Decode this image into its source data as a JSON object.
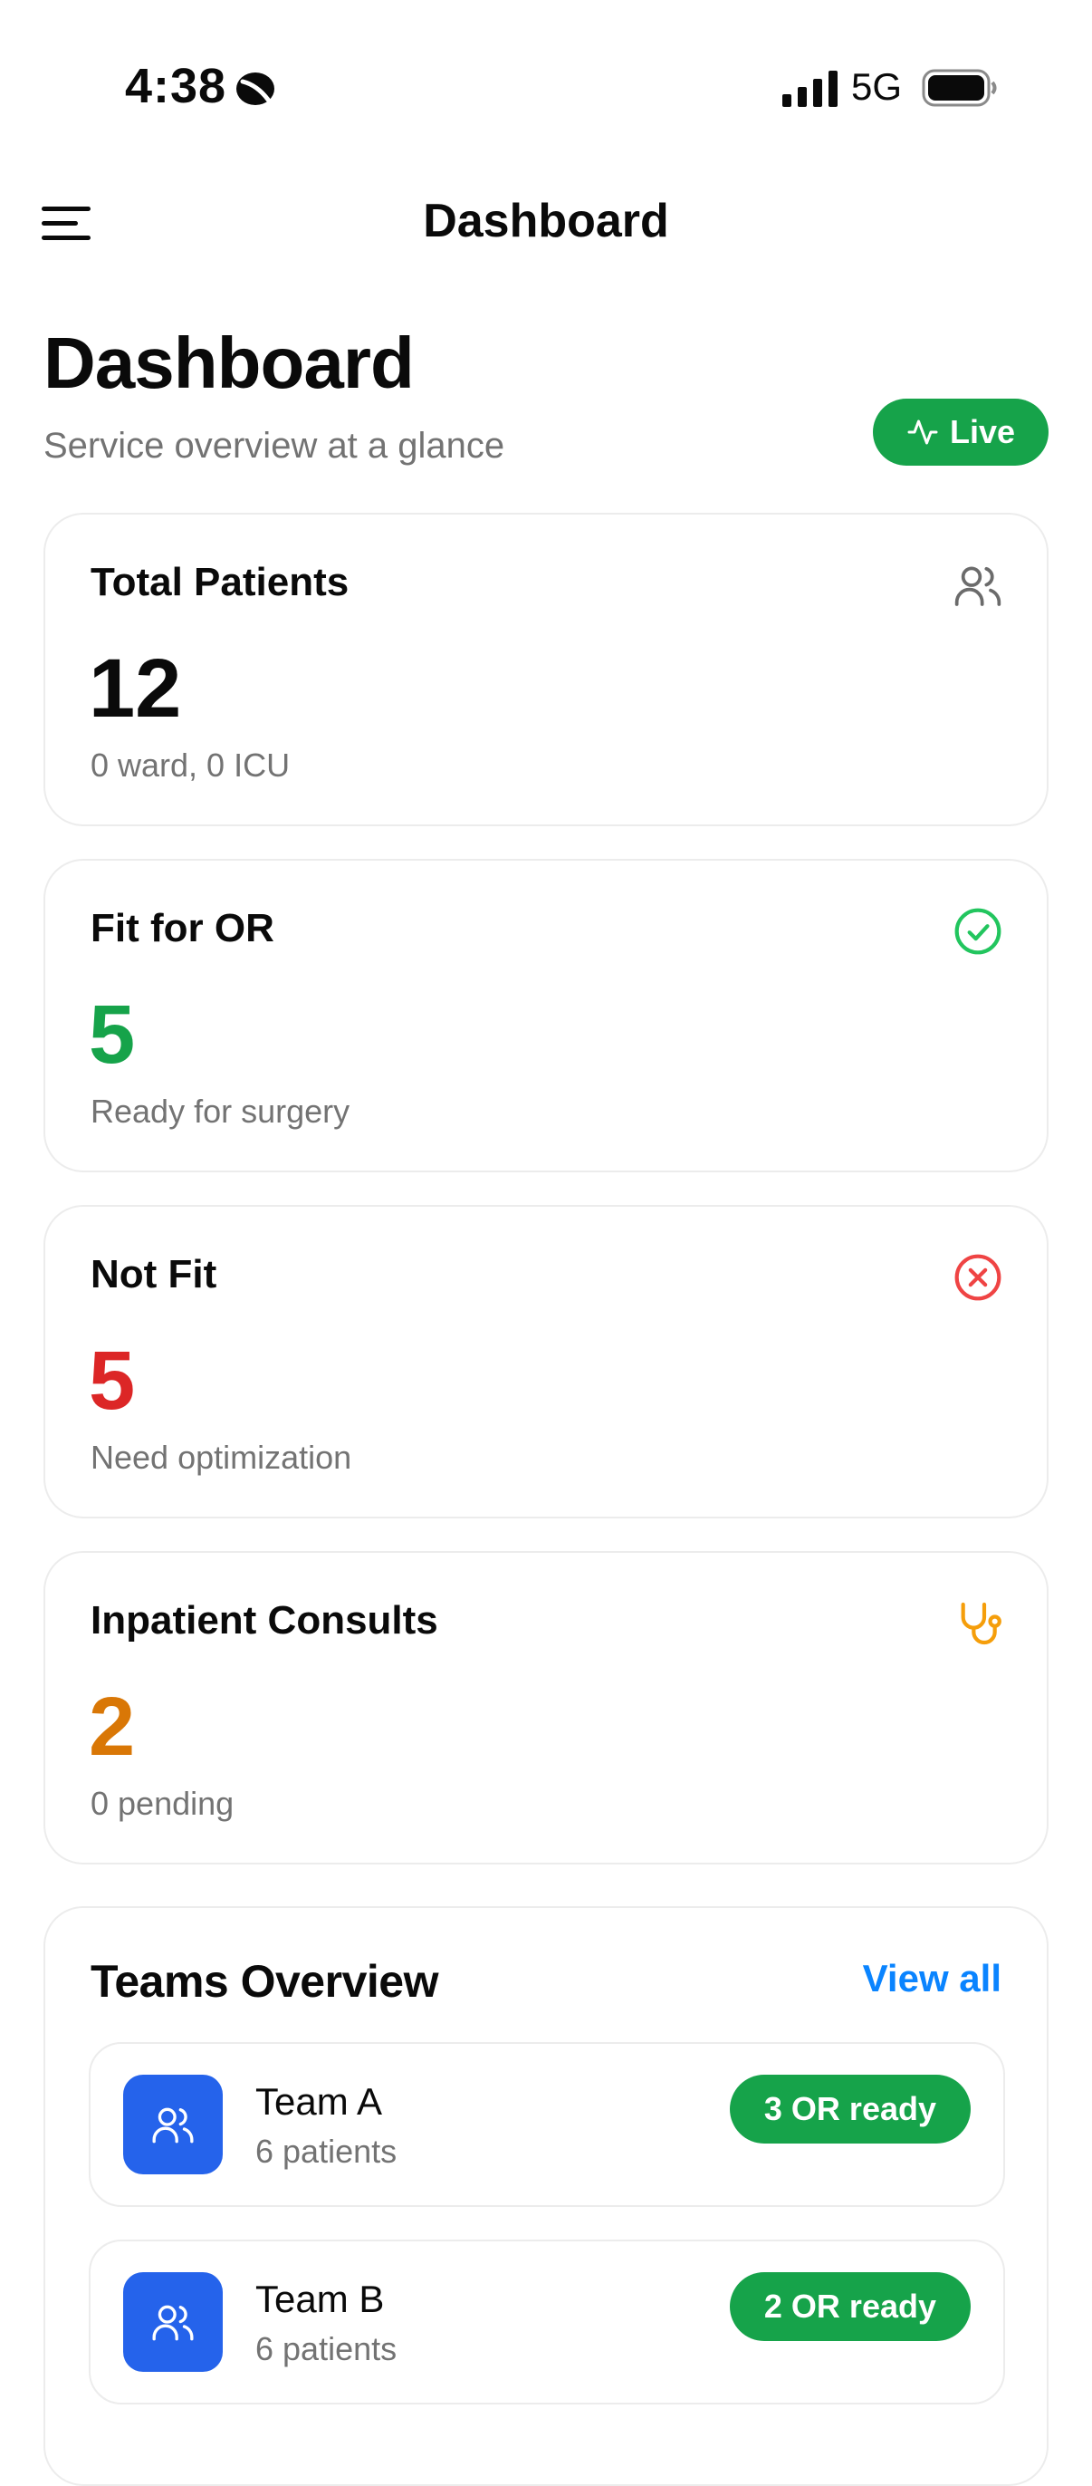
{
  "status_bar": {
    "time": "4:38",
    "network": "5G"
  },
  "nav": {
    "title": "Dashboard"
  },
  "header": {
    "title": "Dashboard",
    "subtitle": "Service overview at a glance",
    "live_label": "Live"
  },
  "stats": [
    {
      "label": "Total Patients",
      "value": "12",
      "sub": "0 ward, 0 ICU",
      "color": "#0a0a0a",
      "icon": "users-icon",
      "icon_color": "#6b6b6b"
    },
    {
      "label": "Fit for OR",
      "value": "5",
      "sub": "Ready for surgery",
      "color": "#16a34a",
      "icon": "check-circle-icon",
      "icon_color": "#22c55e"
    },
    {
      "label": "Not Fit",
      "value": "5",
      "sub": "Need optimization",
      "color": "#dc2626",
      "icon": "x-circle-icon",
      "icon_color": "#ef4444"
    },
    {
      "label": "Inpatient Consults",
      "value": "2",
      "sub": "0 pending",
      "color": "#d97706",
      "icon": "stethoscope-icon",
      "icon_color": "#f59e0b"
    }
  ],
  "teams": {
    "title": "Teams Overview",
    "view_all": "View all",
    "items": [
      {
        "name": "Team A",
        "patients": "6 patients",
        "badge": "3 OR ready"
      },
      {
        "name": "Team B",
        "patients": "6 patients",
        "badge": "2 OR ready"
      }
    ]
  },
  "colors": {
    "accent_green": "#16a34a",
    "link_blue": "#0a84ff",
    "team_blue": "#2563eb"
  }
}
